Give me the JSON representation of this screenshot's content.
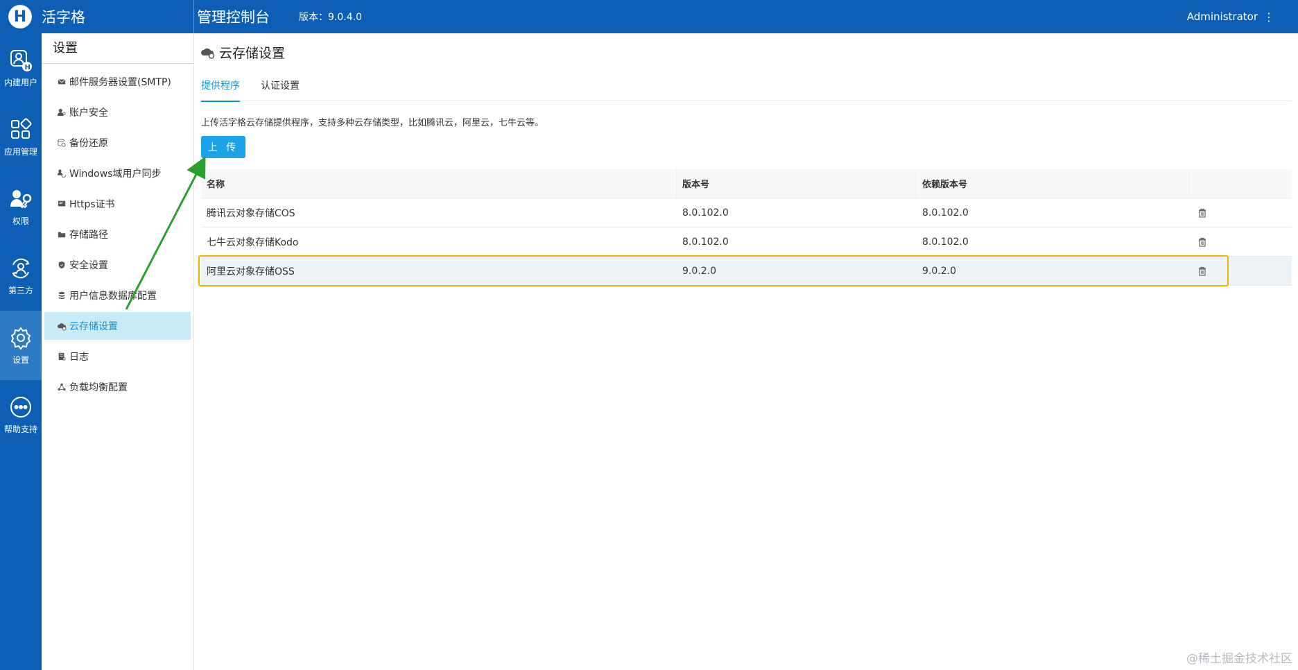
{
  "header": {
    "brand_logo": "H",
    "brand_name": "活字格",
    "console_title": "管理控制台",
    "version": "版本：9.0.4.0",
    "user": "Administrator",
    "user_menu_glyph": "⋮"
  },
  "rail": {
    "items": [
      {
        "label": "内建用户",
        "icon": "builtin-user-icon"
      },
      {
        "label": "应用管理",
        "icon": "app-grid-icon"
      },
      {
        "label": "权限",
        "icon": "permission-key-icon"
      },
      {
        "label": "第三方",
        "icon": "third-party-icon"
      },
      {
        "label": "设置",
        "icon": "gear-icon",
        "active": true
      },
      {
        "label": "帮助支持",
        "icon": "help-chat-icon"
      }
    ]
  },
  "subnav": {
    "title": "设置",
    "items": [
      {
        "label": "邮件服务器设置(SMTP)",
        "icon": "mail-icon"
      },
      {
        "label": "账户安全",
        "icon": "user-key-icon"
      },
      {
        "label": "备份还原",
        "icon": "backup-icon"
      },
      {
        "label": "Windows域用户同步",
        "icon": "user-sync-icon"
      },
      {
        "label": "Https证书",
        "icon": "certificate-icon"
      },
      {
        "label": "存储路径",
        "icon": "folder-icon"
      },
      {
        "label": "安全设置",
        "icon": "shield-icon"
      },
      {
        "label": "用户信息数据库配置",
        "icon": "database-icon"
      },
      {
        "label": "云存储设置",
        "icon": "cloud-gear-icon",
        "active": true
      },
      {
        "label": "日志",
        "icon": "log-icon"
      },
      {
        "label": "负载均衡配置",
        "icon": "cluster-icon"
      }
    ]
  },
  "main": {
    "title": "云存储设置",
    "tabs": [
      {
        "label": "提供程序",
        "active": true
      },
      {
        "label": "认证设置",
        "active": false
      }
    ],
    "description": "上传活字格云存储提供程序，支持多种云存储类型，比如腾讯云，阿里云，七牛云等。",
    "upload_label": "上 传",
    "table": {
      "headers": [
        "名称",
        "版本号",
        "依赖版本号",
        ""
      ],
      "rows": [
        {
          "name": "腾讯云对象存储COS",
          "version": "8.0.102.0",
          "dep_version": "8.0.102.0"
        },
        {
          "name": "七牛云对象存储Kodo",
          "version": "8.0.102.0",
          "dep_version": "8.0.102.0"
        },
        {
          "name": "阿里云对象存储OSS",
          "version": "9.0.2.0",
          "dep_version": "9.0.2.0",
          "highlighted": true
        }
      ]
    }
  },
  "annotation": {
    "highlight_color": "#f5b300",
    "arrow_color": "#2aa12a"
  },
  "watermark": "@稀土掘金技术社区",
  "colors": {
    "primary": "#0d5fb6",
    "accent": "#1aa3e8",
    "active_bg": "#c8ebf7"
  }
}
